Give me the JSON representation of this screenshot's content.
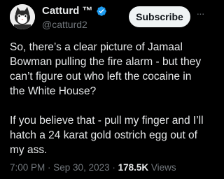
{
  "author": {
    "display_name": "Catturd ™",
    "handle": "@catturd2",
    "avatar_icon": "cat-avatar-icon",
    "verified_icon": "verified-badge-icon",
    "verified_color": "#1d9bf0"
  },
  "actions": {
    "subscribe_label": "Subscribe",
    "more_icon": "···"
  },
  "tweet": {
    "paragraphs": [
      "So, there’s a clear picture of Jamaal\nBowman pulling the fire alarm - but they\ncan’t figure out who left the cocaine in\nthe White House?",
      "If you believe that - pull my finger and I’ll\nhatch a 24 karat gold ostrich egg out of\nmy ass."
    ]
  },
  "meta": {
    "time": "7:00 PM",
    "separator": " · ",
    "date": "Sep 30, 2023",
    "views_count": "178.5K",
    "views_label": " Views"
  }
}
